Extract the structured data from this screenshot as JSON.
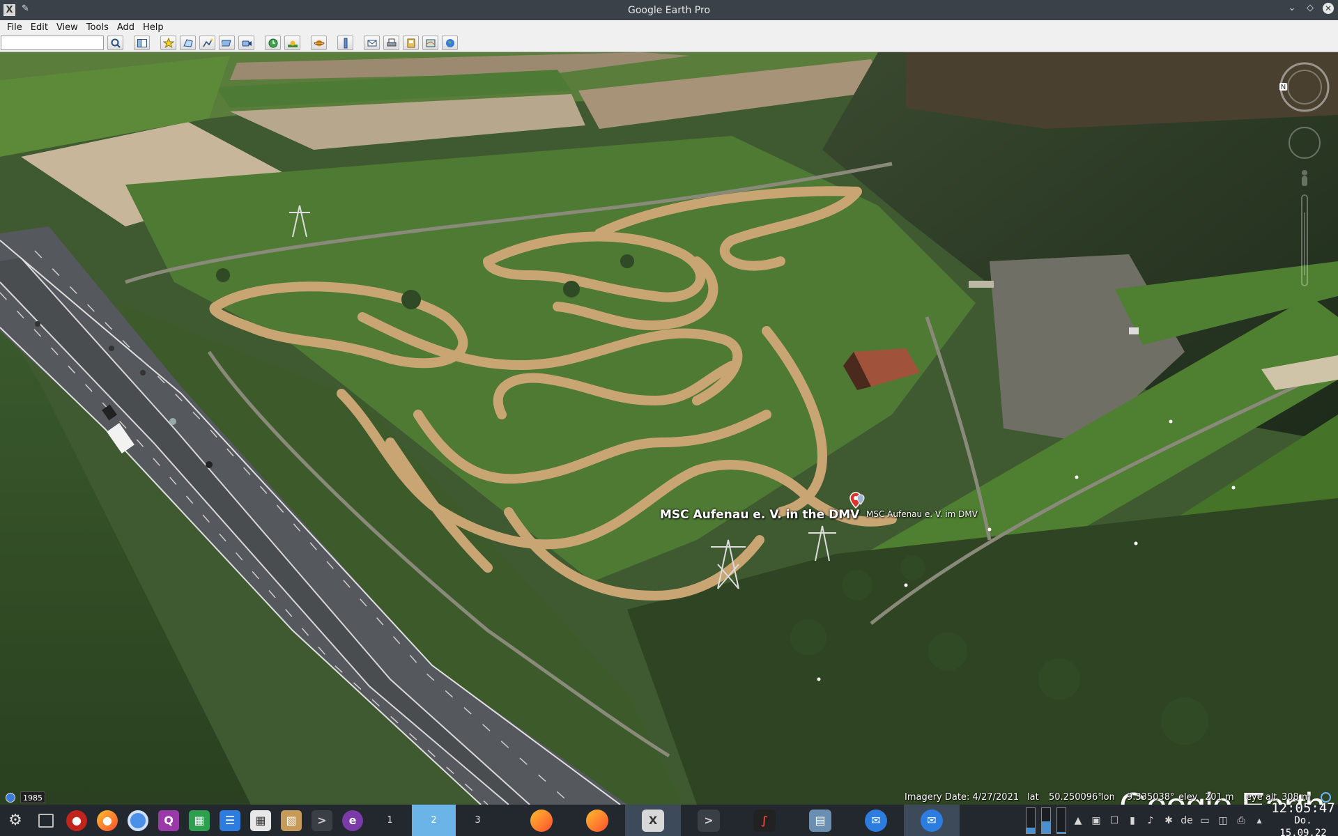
{
  "window": {
    "title": "Google Earth Pro",
    "app_icon": "x-icon",
    "controls": [
      "minimize-icon",
      "maximize-icon",
      "close-icon"
    ]
  },
  "menu": {
    "items": [
      "File",
      "Edit",
      "View",
      "Tools",
      "Add",
      "Help"
    ]
  },
  "toolbar": {
    "search_value": "",
    "buttons": [
      "search-icon",
      "sidebar-icon",
      "placemark-icon",
      "polygon-icon",
      "path-icon",
      "image-overlay-icon",
      "record-tour-icon",
      "historical-imagery-icon",
      "sun-icon",
      "planets-icon",
      "ruler-icon",
      "email-icon",
      "print-icon",
      "save-image-icon",
      "view-in-maps-icon",
      "earth-icon"
    ]
  },
  "map": {
    "placemark_label_en": "MSC Aufenau e. V. in the DMV",
    "placemark_label_de": "MSC Aufenau e. V. im DMV",
    "logo": "Google Earth",
    "history_year": "1985"
  },
  "status": {
    "imagery_date": "Imagery Date: 4/27/2021",
    "lat_label": "lat",
    "lat_value": "50.250096°",
    "lon_label": "lon",
    "lon_value": "9.335038°",
    "elev_label": "elev",
    "elev_value": "201 m",
    "eye_alt_label": "eye alt",
    "eye_alt_value": "308 m"
  },
  "taskbar": {
    "desktops": [
      "1",
      "2",
      "3"
    ],
    "active_desktop": "2",
    "clock_time": "12:05:47",
    "clock_date": "Do. 15.09.22",
    "keyboard_layout": "de",
    "level_meters": [
      0.2,
      0.45,
      0.05
    ]
  },
  "colors": {
    "titlebar": "#3b4148",
    "taskbar": "#23272e",
    "active_desktop": "#6ab4e8",
    "track_dirt": "#c9a574",
    "grass": "#4f7a34"
  }
}
